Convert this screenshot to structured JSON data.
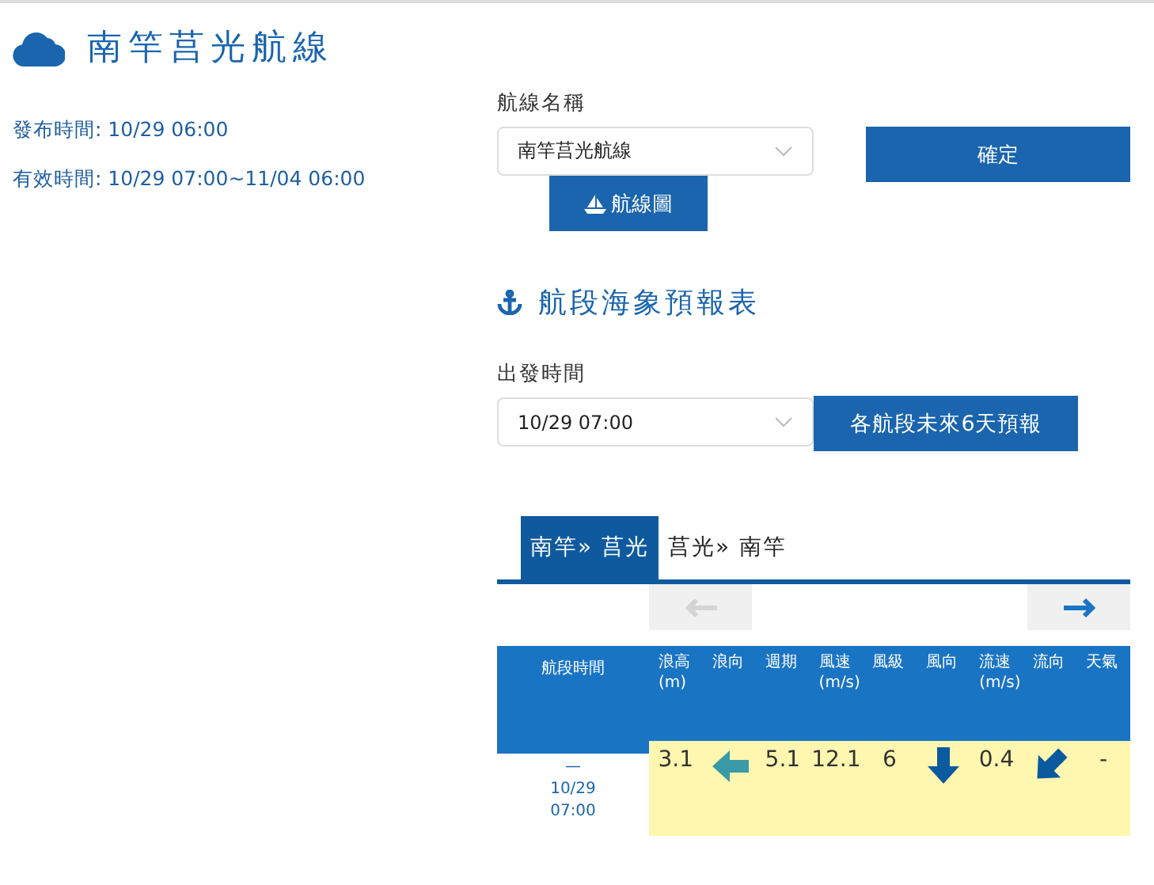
{
  "header": {
    "title": "南竿莒光航線"
  },
  "info": [
    {
      "label": "發布時間:",
      "value": "10/29 06:00"
    },
    {
      "label": "有效時間:",
      "value": "10/29 07:00~11/04 06:00"
    }
  ],
  "route_form": {
    "label": "航線名稱",
    "select_value": "南竿莒光航線",
    "confirm_button": "確定",
    "map_button": "航線圖"
  },
  "forecast": {
    "heading": "航段海象預報表",
    "departure_label": "出發時間",
    "departure_value": "10/29 07:00",
    "six_day_button": "各航段未來6天預報",
    "tabs": [
      {
        "label": "南竿» 莒光",
        "selected": true
      },
      {
        "label": "莒光» 南竿",
        "selected": false
      }
    ],
    "nav": [
      {
        "kind": "prev",
        "disabled": true
      },
      {
        "kind": "next",
        "disabled": false
      }
    ],
    "time_column": "航段時間",
    "columns": [
      {
        "label": "浪高",
        "unit": "(m)"
      },
      {
        "label": "浪向"
      },
      {
        "label": "週期"
      },
      {
        "label": "風速",
        "unit": "(m/s)"
      },
      {
        "label": "風級"
      },
      {
        "label": "風向"
      },
      {
        "label": "流速",
        "unit": "(m/s)"
      },
      {
        "label": "流向"
      },
      {
        "label": "天氣"
      }
    ],
    "rows": [
      {
        "dash": "—",
        "date": "10/29",
        "time": "07:00",
        "cells": [
          {
            "kind": "text",
            "text": "3.1"
          },
          {
            "kind": "arrow_west",
            "color": "#3a9aa8"
          },
          {
            "kind": "text",
            "text": "5.1"
          },
          {
            "kind": "text",
            "text": "12.1"
          },
          {
            "kind": "text",
            "text": "6"
          },
          {
            "kind": "arrow_south",
            "color": "#0b5aa0"
          },
          {
            "kind": "text",
            "text": "0.4"
          },
          {
            "kind": "arrow_southwest",
            "color": "#0b5aa0"
          },
          {
            "kind": "text",
            "text": "-"
          }
        ]
      }
    ]
  }
}
